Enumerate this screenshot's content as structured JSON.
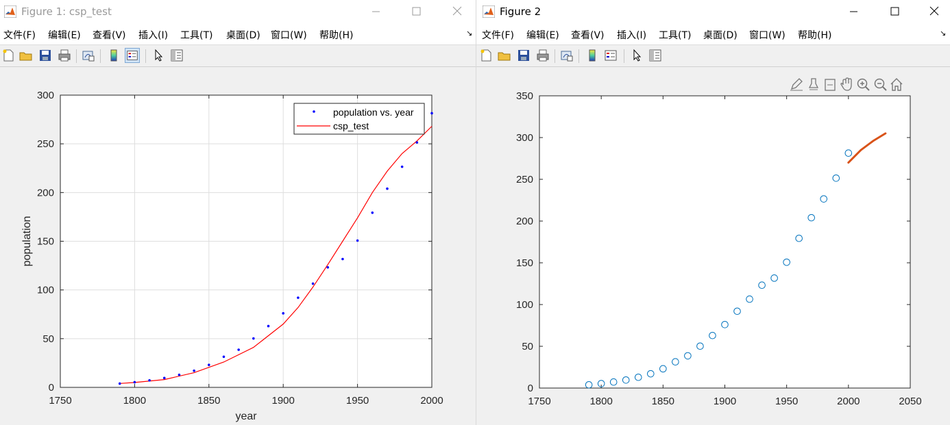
{
  "fig1": {
    "title": "Figure 1: csp_test",
    "menu": [
      "文件(F)",
      "编辑(E)",
      "查看(V)",
      "插入(I)",
      "工具(T)",
      "桌面(D)",
      "窗口(W)",
      "帮助(H)"
    ],
    "axes": {
      "xlabel": "year",
      "ylabel": "population",
      "xlim": [
        1750,
        2000
      ],
      "ylim": [
        0,
        300
      ],
      "xticks": [
        "1750",
        "1800",
        "1850",
        "1900",
        "1950",
        "2000"
      ],
      "yticks": [
        "0",
        "50",
        "100",
        "150",
        "200",
        "250",
        "300"
      ],
      "grid": true,
      "legend": [
        "population vs. year",
        "csp_test"
      ],
      "legend_location": "top-right"
    }
  },
  "fig2": {
    "title": "Figure 2",
    "menu": [
      "文件(F)",
      "编辑(E)",
      "查看(V)",
      "插入(I)",
      "工具(T)",
      "桌面(D)",
      "窗口(W)",
      "帮助(H)"
    ],
    "axes": {
      "xlim": [
        1750,
        2050
      ],
      "ylim": [
        0,
        350
      ],
      "xticks": [
        "1750",
        "1800",
        "1850",
        "1900",
        "1950",
        "2000",
        "2050"
      ],
      "yticks": [
        "0",
        "50",
        "100",
        "150",
        "200",
        "250",
        "300",
        "350"
      ],
      "grid": false
    }
  },
  "colors": {
    "data_points_fig1": "#0000ff",
    "fit_line_fig1": "#ff0000",
    "data_points_fig2": "#0072bd",
    "forecast_line_fig2": "#d95319"
  },
  "chart_data": [
    {
      "type": "scatter",
      "x": [
        1790,
        1800,
        1810,
        1820,
        1830,
        1840,
        1850,
        1860,
        1870,
        1880,
        1890,
        1900,
        1910,
        1920,
        1930,
        1940,
        1950,
        1960,
        1970,
        1980,
        1990,
        2000
      ],
      "series": [
        {
          "name": "population vs. year",
          "values": [
            3.9,
            5.3,
            7.2,
            9.6,
            12.9,
            17.1,
            23.1,
            31.4,
            38.6,
            50.2,
            62.9,
            76.0,
            92.0,
            106.5,
            123.2,
            131.7,
            150.7,
            179.3,
            204.0,
            226.5,
            251.4,
            281.4
          ]
        },
        {
          "name": "csp_test",
          "type": "line",
          "x": [
            1790,
            1800,
            1820,
            1840,
            1860,
            1880,
            1900,
            1910,
            1920,
            1930,
            1940,
            1950,
            1960,
            1970,
            1980,
            1990,
            2000
          ],
          "values": [
            4,
            5,
            8,
            15,
            26,
            41,
            65,
            82,
            103,
            126,
            150,
            174,
            200,
            222,
            240,
            253,
            268
          ]
        }
      ],
      "xlabel": "year",
      "ylabel": "population",
      "xlim": [
        1750,
        2000
      ],
      "ylim": [
        0,
        300
      ],
      "grid": true
    },
    {
      "type": "scatter",
      "x": [
        1790,
        1800,
        1810,
        1820,
        1830,
        1840,
        1850,
        1860,
        1870,
        1880,
        1890,
        1900,
        1910,
        1920,
        1930,
        1940,
        1950,
        1960,
        1970,
        1980,
        1990,
        2000
      ],
      "series": [
        {
          "values": [
            3.9,
            5.3,
            7.2,
            9.6,
            12.9,
            17.1,
            23.1,
            31.4,
            38.6,
            50.2,
            62.9,
            76.0,
            92.0,
            106.5,
            123.2,
            131.7,
            150.7,
            179.3,
            204.0,
            226.5,
            251.4,
            281.4
          ]
        },
        {
          "type": "line",
          "x": [
            2000,
            2010,
            2020,
            2030
          ],
          "values": [
            270,
            285,
            296,
            305
          ]
        }
      ],
      "xlim": [
        1750,
        2050
      ],
      "ylim": [
        0,
        350
      ],
      "grid": false
    }
  ]
}
